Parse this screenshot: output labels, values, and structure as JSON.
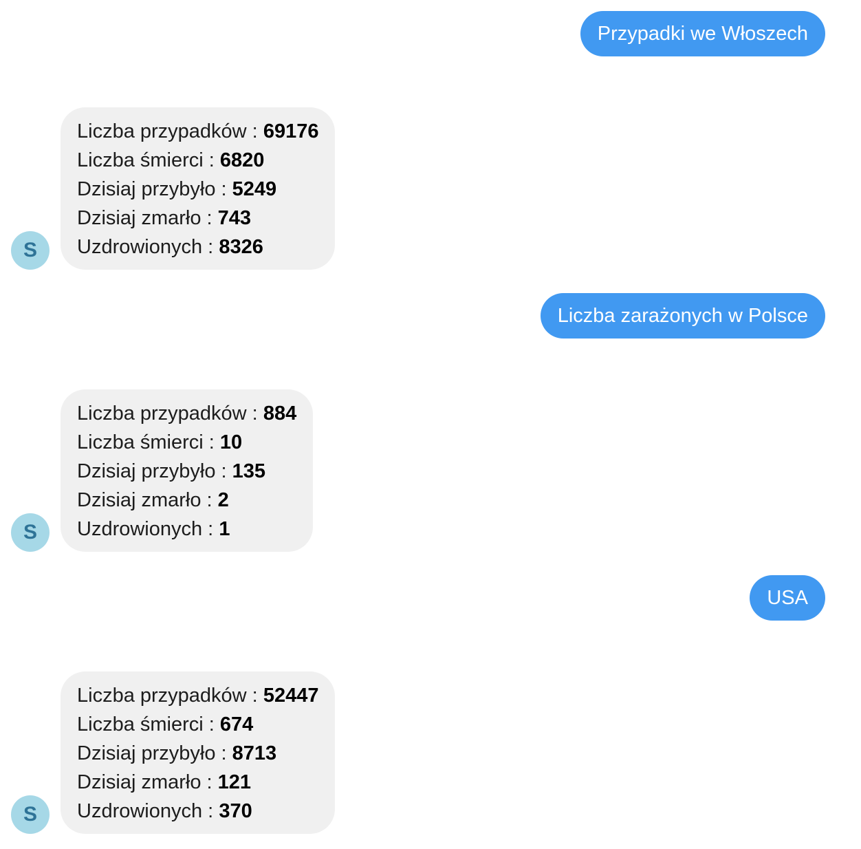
{
  "conversation": [
    {
      "user": "Przypadki we Włoszech",
      "bot": {
        "avatar_letter": "S",
        "stats": [
          {
            "label": "Liczba przypadków : ",
            "value": "69176"
          },
          {
            "label": "Liczba śmierci : ",
            "value": "6820"
          },
          {
            "label": "Dzisiaj przybyło : ",
            "value": "5249"
          },
          {
            "label": "Dzisiaj zmarło : ",
            "value": "743"
          },
          {
            "label": "Uzdrowionych : ",
            "value": "8326"
          }
        ]
      }
    },
    {
      "user": "Liczba zarażonych w Polsce",
      "bot": {
        "avatar_letter": "S",
        "stats": [
          {
            "label": "Liczba przypadków : ",
            "value": "884"
          },
          {
            "label": "Liczba śmierci : ",
            "value": "10"
          },
          {
            "label": "Dzisiaj przybyło : ",
            "value": "135"
          },
          {
            "label": "Dzisiaj zmarło : ",
            "value": "2"
          },
          {
            "label": "Uzdrowionych : ",
            "value": "1"
          }
        ]
      }
    },
    {
      "user": "USA",
      "bot": {
        "avatar_letter": "S",
        "stats": [
          {
            "label": "Liczba przypadków : ",
            "value": "52447"
          },
          {
            "label": "Liczba śmierci : ",
            "value": "674"
          },
          {
            "label": "Dzisiaj przybyło : ",
            "value": "8713"
          },
          {
            "label": "Dzisiaj zmarło : ",
            "value": "121"
          },
          {
            "label": "Uzdrowionych : ",
            "value": "370"
          }
        ]
      }
    }
  ],
  "colors": {
    "user_bubble": "#4199f1",
    "bot_bubble": "#f0f0f0",
    "avatar_bg": "#a6d8e7",
    "avatar_text": "#2e7397"
  }
}
